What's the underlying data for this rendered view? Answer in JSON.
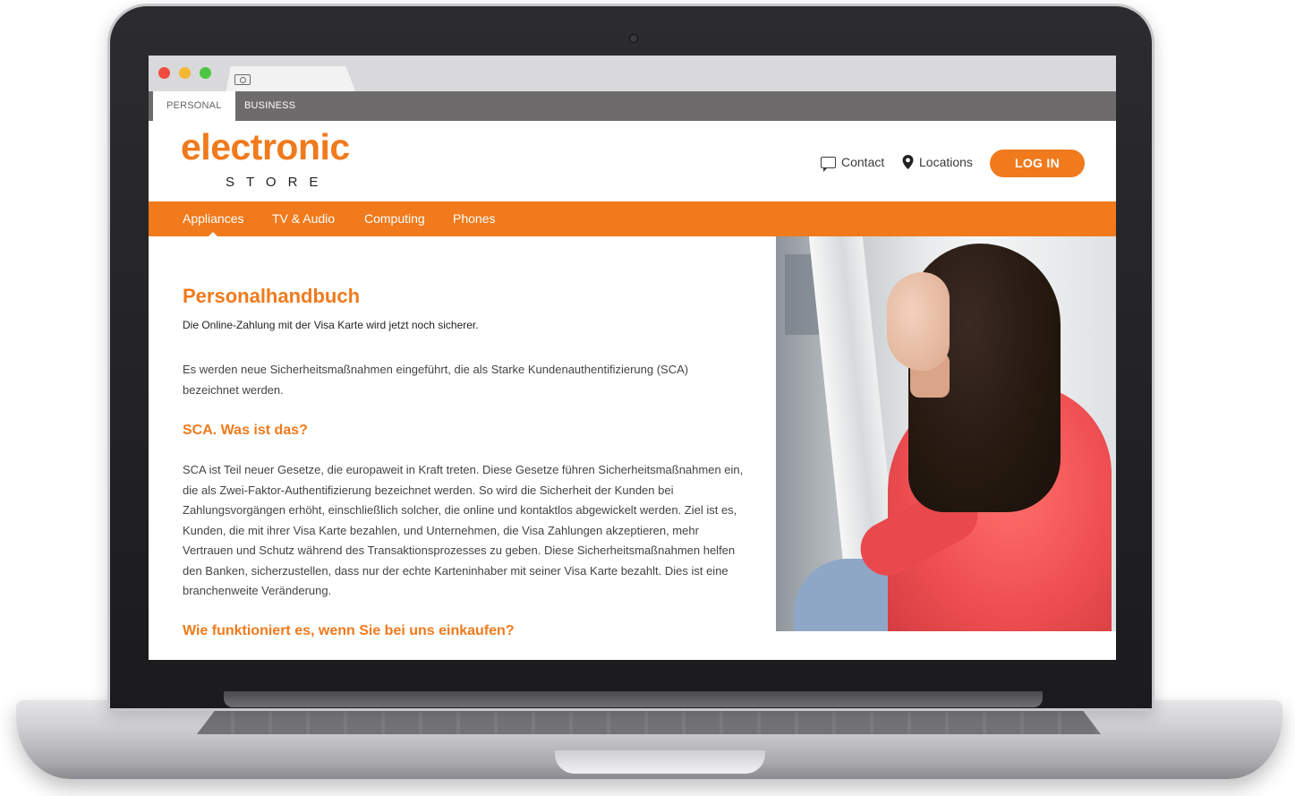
{
  "browser": {
    "tab_icon": "money-icon"
  },
  "segments": {
    "personal": "PERSONAL",
    "business": "BUSINESS"
  },
  "header": {
    "logo_top": "electronic",
    "logo_bottom": "STORE",
    "contact": "Contact",
    "locations": "Locations",
    "login": "LOG IN"
  },
  "nav": {
    "items": [
      {
        "label": "Appliances",
        "active": true
      },
      {
        "label": "TV & Audio",
        "active": false
      },
      {
        "label": "Computing",
        "active": false
      },
      {
        "label": "Phones",
        "active": false
      }
    ]
  },
  "content": {
    "title": "Personalhandbuch",
    "lead": "Die Online-Zahlung mit der Visa Karte wird jetzt noch sicherer.",
    "paragraph_1": "Es werden neue Sicherheitsmaßnahmen eingeführt, die als Starke Kundenauthentifizierung (SCA) bezeichnet werden.",
    "heading_1": "SCA. Was ist das?",
    "paragraph_2": "SCA ist Teil neuer Gesetze, die europaweit in Kraft treten. Diese Gesetze führen Sicherheitsmaßnahmen ein, die als Zwei-Faktor-Authentifizierung bezeichnet werden. So wird die Sicherheit der Kunden bei Zahlungsvorgängen erhöht, einschließlich solcher, die online und kontaktlos abgewickelt werden. Ziel ist es, Kunden, die mit ihrer Visa Karte bezahlen, und Unternehmen, die Visa Zahlungen akzeptieren, mehr Vertrauen und Schutz während des Transaktionsprozesses zu geben. Diese Sicherheitsmaßnahmen helfen den Banken, sicherzustellen, dass nur der echte Karteninhaber mit seiner Visa Karte bezahlt. Dies ist eine branchenweite Veränderung.",
    "heading_2": "Wie funktioniert es, wenn Sie bei uns einkaufen?"
  },
  "colors": {
    "accent": "#f07a1c",
    "segment_bar": "#6e6b6c",
    "browser_bar": "#d9d9db"
  }
}
